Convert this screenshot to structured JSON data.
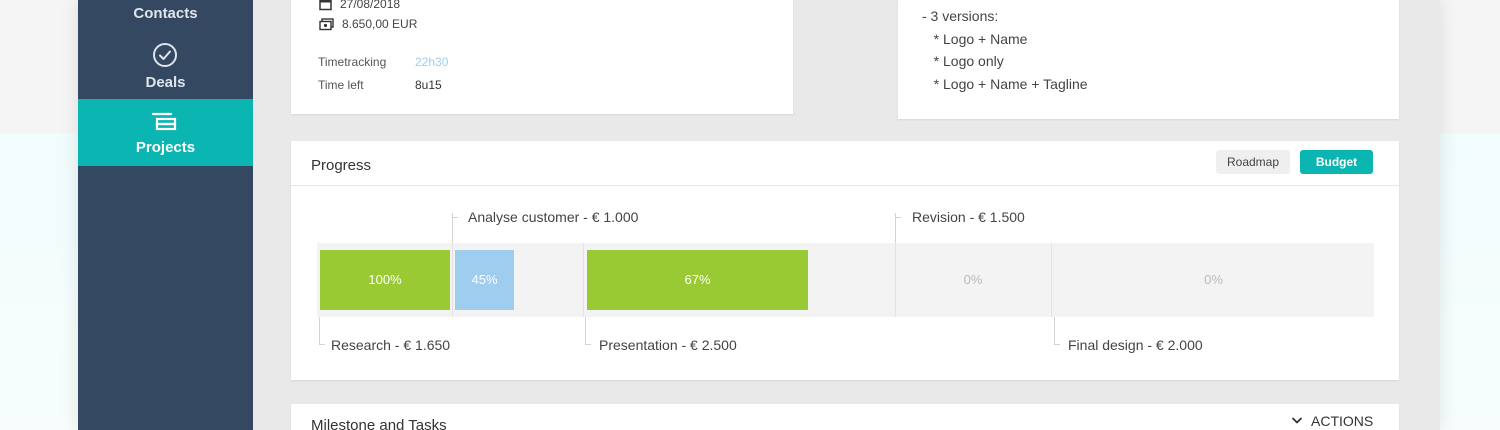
{
  "sidebar": {
    "items": [
      {
        "label": "Contacts",
        "icon": "contacts-icon"
      },
      {
        "label": "Deals",
        "icon": "check-circle-icon"
      },
      {
        "label": "Projects",
        "icon": "projects-icon",
        "active": true
      }
    ]
  },
  "project_info": {
    "date": "27/08/2018",
    "amount": "8.650,00 EUR",
    "timetracking_label": "Timetracking",
    "timetracking_value": "22h30",
    "time_left_label": "Time left",
    "time_left_value": "8u15"
  },
  "description": {
    "lines": [
      "- 3 versions:",
      "   * Logo + Name",
      "   * Logo only",
      "   * Logo + Name + Tagline"
    ]
  },
  "progress": {
    "title": "Progress",
    "roadmap_label": "Roadmap",
    "budget_label": "Budget",
    "milestones": [
      {
        "label": "Research - € 1.650",
        "percent_label": "100%",
        "percent": 100
      },
      {
        "label": "Analyse customer - € 1.000",
        "percent_label": "45%",
        "percent": 45
      },
      {
        "label": "Presentation - € 2.500",
        "percent_label": "67%",
        "percent": 67
      },
      {
        "label": "Revision - € 1.500",
        "percent_label": "0%",
        "percent": 0
      },
      {
        "label": "Final design - € 2.000",
        "percent_label": "0%",
        "percent": 0
      }
    ]
  },
  "milestones_section": {
    "title": "Milestone and Tasks",
    "actions_label": "ACTIONS"
  },
  "colors": {
    "accent": "#0bb5b1",
    "sidebar": "#344861",
    "complete": "#99c933",
    "in_progress": "#9fcdf0"
  }
}
